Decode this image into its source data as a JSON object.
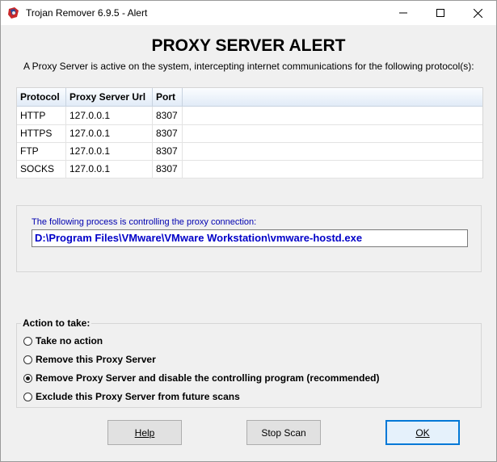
{
  "window": {
    "title": "Trojan Remover 6.9.5 - Alert"
  },
  "heading": "PROXY SERVER ALERT",
  "subtitle": "A Proxy Server is active on the system, intercepting internet communications for the following protocol(s):",
  "table": {
    "headers": [
      "Protocol",
      "Proxy Server Url",
      "Port"
    ],
    "rows": [
      [
        "HTTP",
        "127.0.0.1",
        "8307"
      ],
      [
        "HTTPS",
        "127.0.0.1",
        "8307"
      ],
      [
        "FTP",
        "127.0.0.1",
        "8307"
      ],
      [
        "SOCKS",
        "127.0.0.1",
        "8307"
      ]
    ]
  },
  "process": {
    "label": "The following process is controlling the proxy connection:",
    "path": "D:\\Program Files\\VMware\\VMware Workstation\\vmware-hostd.exe"
  },
  "actions": {
    "legend": "Action to take:",
    "options": [
      "Take no action",
      "Remove this Proxy Server",
      "Remove Proxy Server and disable the controlling program (recommended)",
      "Exclude this Proxy Server from future scans"
    ],
    "selected_index": 2
  },
  "buttons": {
    "help": "Help",
    "stop_scan": "Stop Scan",
    "ok": "OK"
  },
  "colors": {
    "process_text": "#0000c8",
    "default_button_border": "#0078d7"
  },
  "icons": {
    "app": "trojan-remover-icon",
    "minimize": "minimize-icon",
    "maximize": "maximize-icon",
    "close": "close-icon"
  }
}
